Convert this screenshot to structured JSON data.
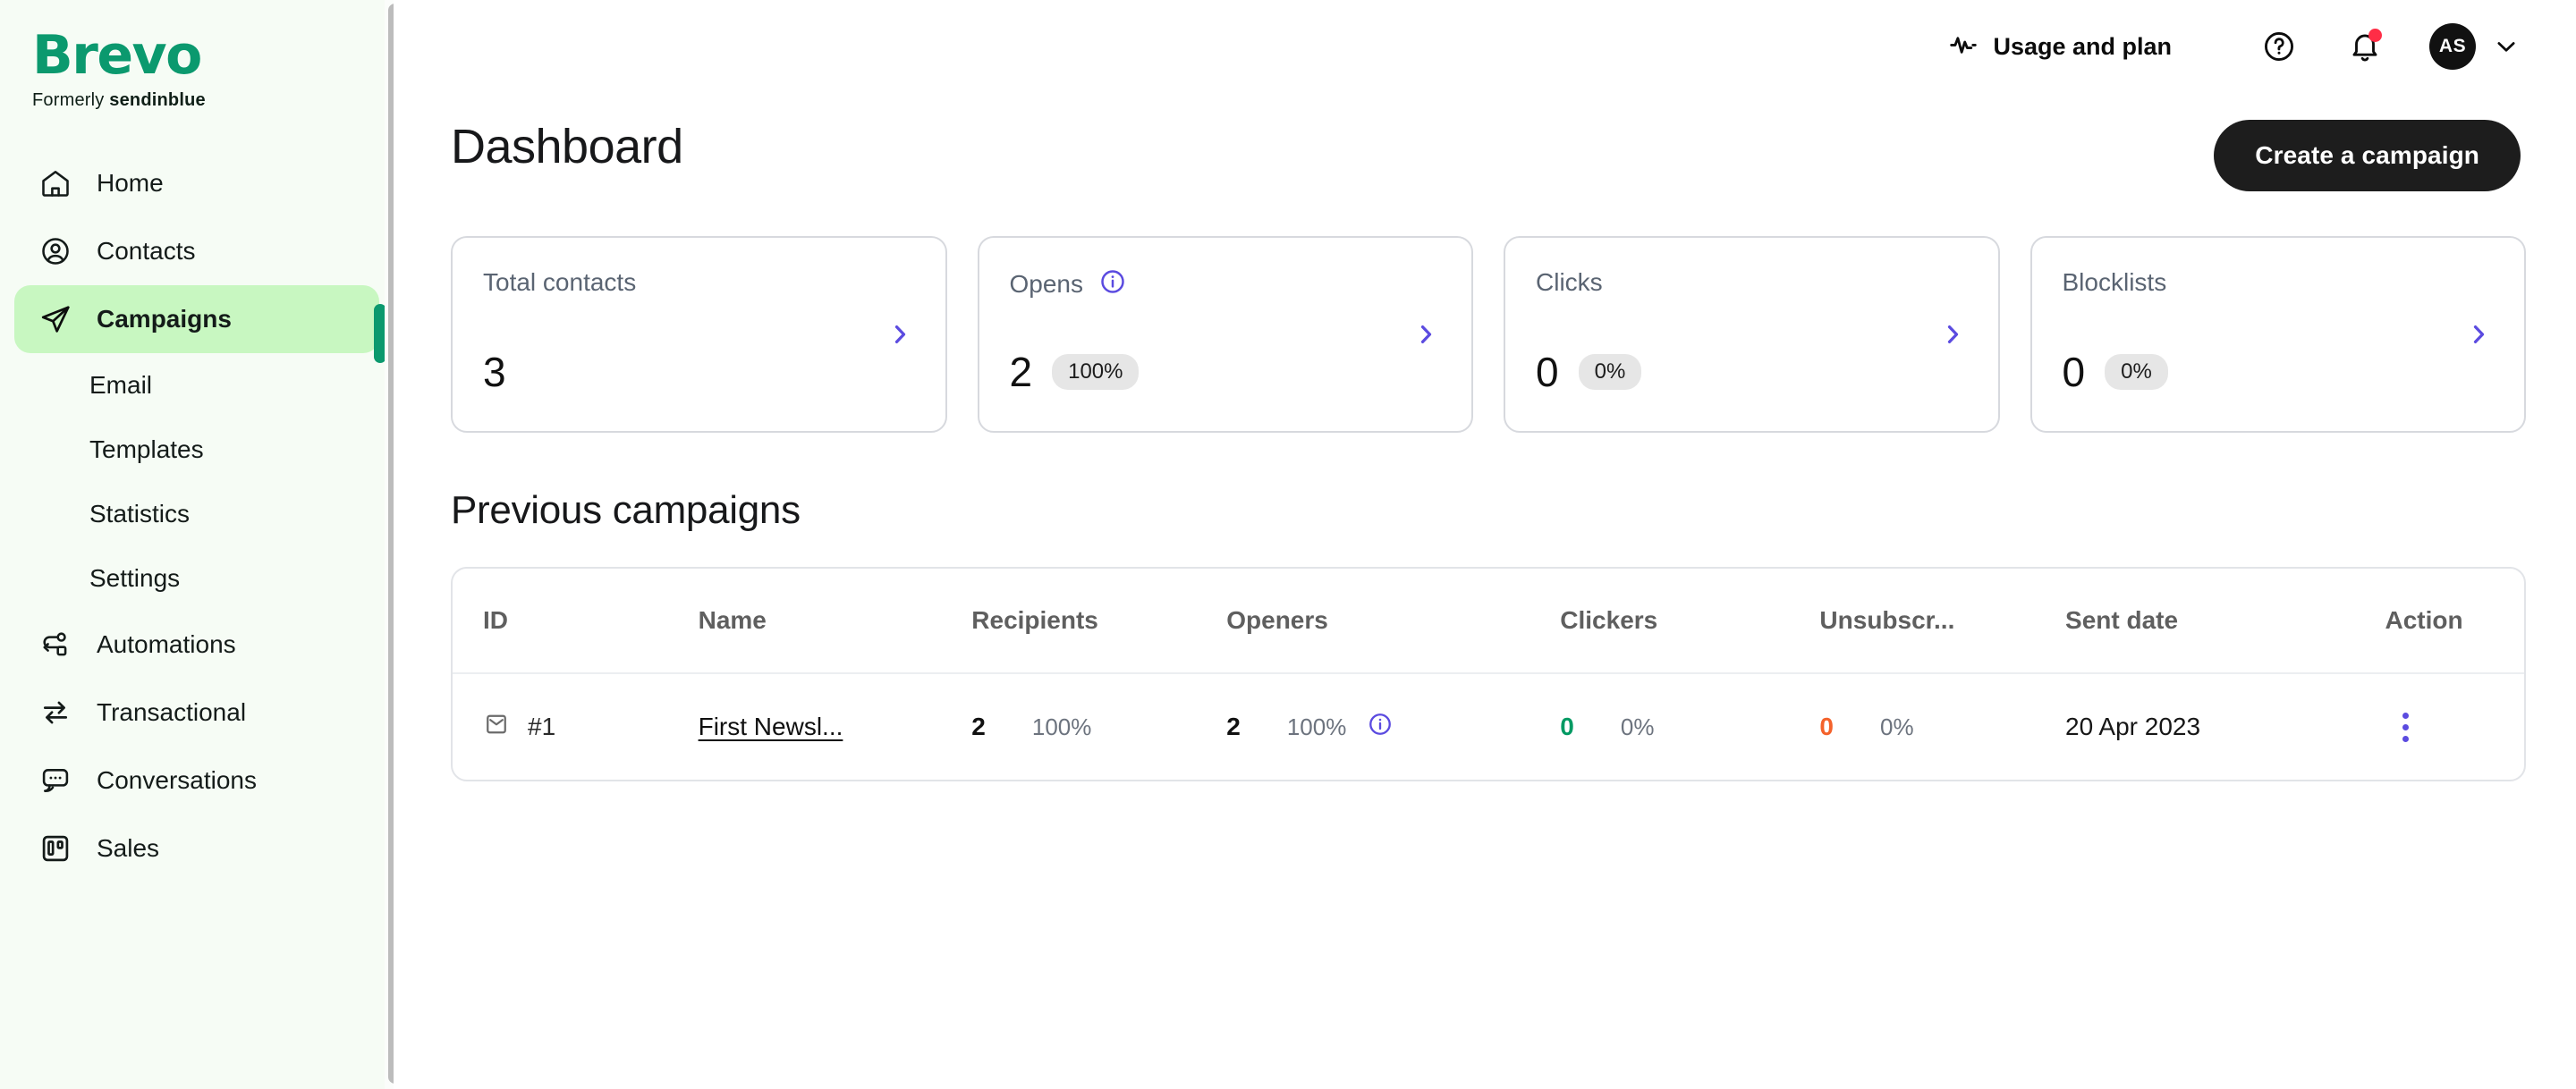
{
  "brand": {
    "name": "Brevo",
    "tagline_prefix": "Formerly ",
    "tagline_strong": "sendinblue",
    "green": "#0b996e",
    "active_bg": "#c8f7c1",
    "sidebar_bg": "#f6fcf5"
  },
  "sidebar": {
    "items": [
      {
        "label": "Home",
        "icon": "home-icon"
      },
      {
        "label": "Contacts",
        "icon": "contacts-icon"
      },
      {
        "label": "Campaigns",
        "icon": "paper-plane-icon",
        "active": true
      },
      {
        "label": "Automations",
        "icon": "automations-icon"
      },
      {
        "label": "Transactional",
        "icon": "transactional-icon"
      },
      {
        "label": "Conversations",
        "icon": "conversations-icon"
      },
      {
        "label": "Sales",
        "icon": "sales-icon"
      }
    ],
    "subitems": [
      {
        "label": "Email"
      },
      {
        "label": "Templates"
      },
      {
        "label": "Statistics"
      },
      {
        "label": "Settings"
      }
    ]
  },
  "topbar": {
    "usage_label": "Usage and plan",
    "usage_icon": "activity-pulse-icon",
    "help_icon": "help-circle-icon",
    "notifications_icon": "bell-icon",
    "notification_dot_color": "#ff2d46",
    "avatar_initials": "AS",
    "account_chevron_icon": "chevron-down-icon"
  },
  "page": {
    "title": "Dashboard",
    "cta_label": "Create a campaign",
    "section_title": "Previous campaigns"
  },
  "cards": [
    {
      "label": "Total contacts",
      "value": "3",
      "badge": null,
      "has_info": false,
      "arrow_icon": "chevron-right-icon"
    },
    {
      "label": "Opens",
      "value": "2",
      "badge": "100%",
      "has_info": true,
      "arrow_icon": "chevron-right-icon"
    },
    {
      "label": "Clicks",
      "value": "0",
      "badge": "0%",
      "has_info": false,
      "arrow_icon": "chevron-right-icon"
    },
    {
      "label": "Blocklists",
      "value": "0",
      "badge": "0%",
      "has_info": false,
      "arrow_icon": "chevron-right-icon"
    }
  ],
  "table": {
    "headers": {
      "id": "ID",
      "name": "Name",
      "recipients": "Recipients",
      "openers": "Openers",
      "clickers": "Clickers",
      "unsubscribers": "Unsubscr...",
      "sent_date": "Sent date",
      "action": "Action"
    },
    "rows": [
      {
        "id": "#1",
        "id_icon": "envelope-icon",
        "name": "First Newsl...",
        "recipients": "2",
        "recipients_pct": "100%",
        "openers": "2",
        "openers_pct": "100%",
        "openers_info_icon": "info-circle-icon",
        "clickers": "0",
        "clickers_pct": "0%",
        "unsubscribers": "0",
        "unsubscribers_pct": "0%",
        "sent_date": "20 Apr 2023",
        "action_icon": "kebab-menu-icon"
      }
    ]
  }
}
